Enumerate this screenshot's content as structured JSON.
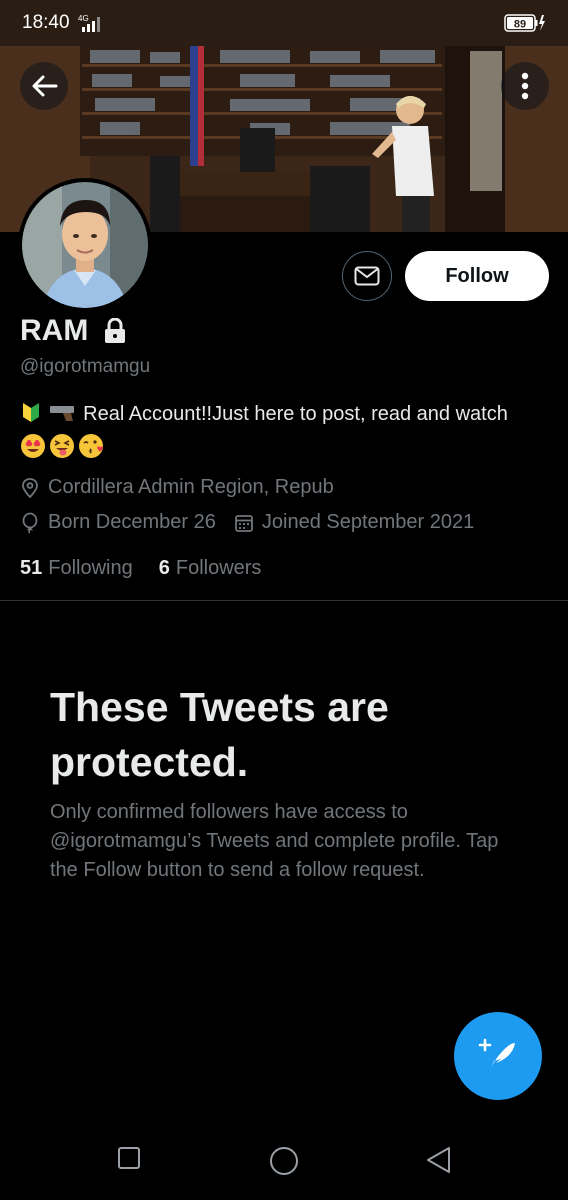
{
  "status_bar": {
    "time": "18:40",
    "network": "4G",
    "battery": "89"
  },
  "profile": {
    "display_name": "RAM",
    "handle": "@igorotmamgu",
    "bio_text": "Real Account!!Just here to post, read and watch",
    "bio_emoji_prefix": [
      "japanese-beginner-symbol",
      "pistol"
    ],
    "bio_emoji_suffix": [
      "heart-eyes-face",
      "tongue-squint-face",
      "kissing-heart-face"
    ],
    "location": "Cordillera Admin Region, Repub",
    "born": "Born December 26",
    "joined": "Joined September 2021",
    "following_count": "51",
    "following_label": "Following",
    "followers_count": "6",
    "followers_label": "Followers"
  },
  "actions": {
    "follow_label": "Follow"
  },
  "protected": {
    "title": "These Tweets are protected.",
    "description": "Only confirmed followers have access to @igorotmamgu’s Tweets and complete profile. Tap the Follow button to send a follow request."
  },
  "colors": {
    "accent": "#1d9bf0",
    "background": "#000000",
    "secondary_text": "#71767b"
  }
}
